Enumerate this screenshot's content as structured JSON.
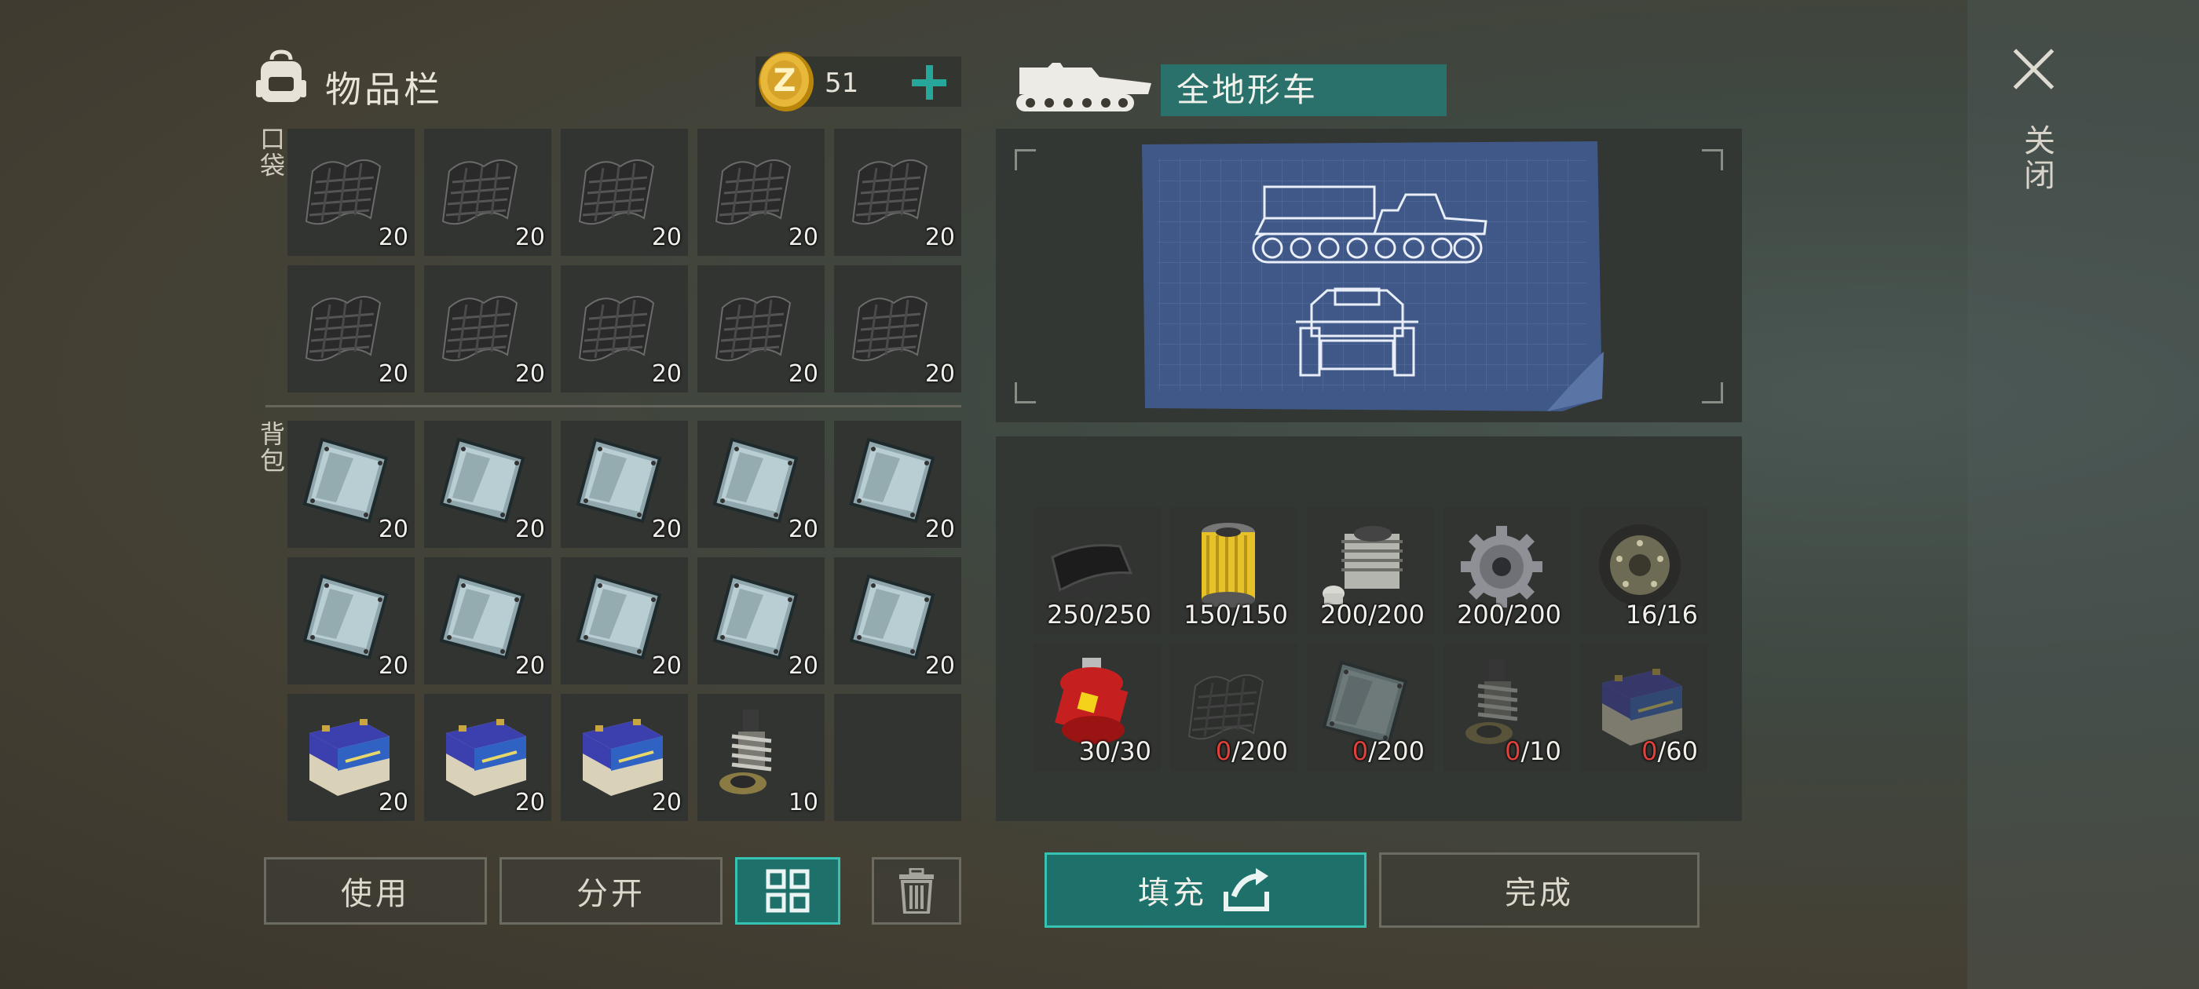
{
  "inventory": {
    "title": "物品栏",
    "coins": "51",
    "pocket_label": "口袋",
    "backpack_label": "背包",
    "pocket_slots": [
      {
        "item": "carbon-fiber-sheet-icon",
        "count": "20"
      },
      {
        "item": "carbon-fiber-sheet-icon",
        "count": "20"
      },
      {
        "item": "carbon-fiber-sheet-icon",
        "count": "20"
      },
      {
        "item": "carbon-fiber-sheet-icon",
        "count": "20"
      },
      {
        "item": "carbon-fiber-sheet-icon",
        "count": "20"
      },
      {
        "item": "carbon-fiber-sheet-icon",
        "count": "20"
      },
      {
        "item": "carbon-fiber-sheet-icon",
        "count": "20"
      },
      {
        "item": "carbon-fiber-sheet-icon",
        "count": "20"
      },
      {
        "item": "carbon-fiber-sheet-icon",
        "count": "20"
      },
      {
        "item": "carbon-fiber-sheet-icon",
        "count": "20"
      }
    ],
    "backpack_slots": [
      {
        "item": "metal-plate-icon",
        "count": "20"
      },
      {
        "item": "metal-plate-icon",
        "count": "20"
      },
      {
        "item": "metal-plate-icon",
        "count": "20"
      },
      {
        "item": "metal-plate-icon",
        "count": "20"
      },
      {
        "item": "metal-plate-icon",
        "count": "20"
      },
      {
        "item": "metal-plate-icon",
        "count": "20"
      },
      {
        "item": "metal-plate-icon",
        "count": "20"
      },
      {
        "item": "metal-plate-icon",
        "count": "20"
      },
      {
        "item": "metal-plate-icon",
        "count": "20"
      },
      {
        "item": "metal-plate-icon",
        "count": "20"
      },
      {
        "item": "battery-icon",
        "count": "20"
      },
      {
        "item": "battery-icon",
        "count": "20"
      },
      {
        "item": "battery-icon",
        "count": "20"
      },
      {
        "item": "shock-absorber-icon",
        "count": "10"
      },
      {
        "item": "empty",
        "count": ""
      }
    ],
    "buttons": {
      "use": "使用",
      "split": "分开"
    }
  },
  "vehicle": {
    "name": "全地形车",
    "requirements": [
      {
        "item": "rubber-sheet-icon",
        "have": "250",
        "need": "/250",
        "short": false
      },
      {
        "item": "oil-filter-icon",
        "have": "150",
        "need": "/150",
        "short": false
      },
      {
        "item": "engine-cylinder-icon",
        "have": "200",
        "need": "/200",
        "short": false
      },
      {
        "item": "gear-icon",
        "have": "200",
        "need": "/200",
        "short": false
      },
      {
        "item": "wheel-icon",
        "have": "16",
        "need": "/16",
        "short": false
      },
      {
        "item": "gas-cylinder-icon",
        "have": "30",
        "need": "/30",
        "short": false
      },
      {
        "item": "carbon-fiber-sheet-icon",
        "have": "0",
        "need": "/200",
        "short": true
      },
      {
        "item": "metal-plate-icon",
        "have": "0",
        "need": "/200",
        "short": true
      },
      {
        "item": "shock-absorber-icon",
        "have": "0",
        "need": "/10",
        "short": true
      },
      {
        "item": "battery-icon",
        "have": "0",
        "need": "/60",
        "short": true
      }
    ],
    "fill_label": "填充",
    "done_label": "完成"
  },
  "close_label": "关闭",
  "colors": {
    "accent": "#27a69a",
    "shortage": "#e0413a",
    "slot": "#313431"
  }
}
